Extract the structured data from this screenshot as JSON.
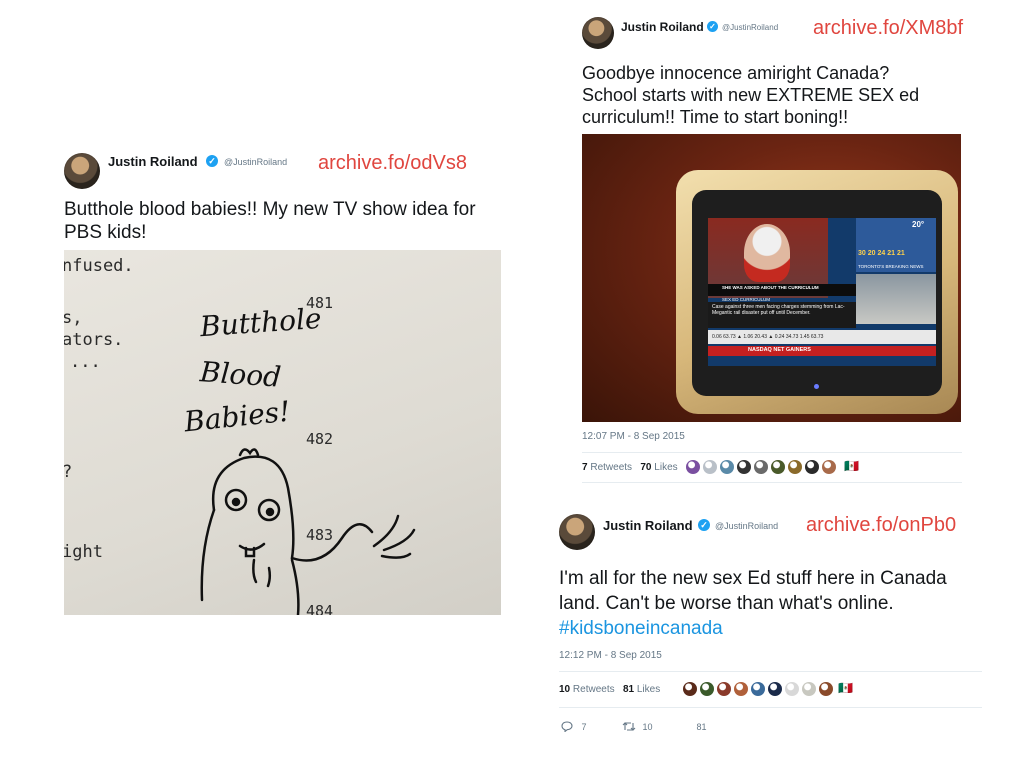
{
  "tweets": {
    "left": {
      "author": "Justin Roiland",
      "handle": "@JustinRoiland",
      "archive": "archive.fo/odVs8",
      "text": "Butthole blood babies!! My new TV show idea for PBS kids!",
      "photo": {
        "typed_text": [
          "nfused.",
          "s,",
          "ators.",
          "...",
          "?",
          "ight"
        ],
        "line_numbers": [
          "481",
          "482",
          "483",
          "484"
        ],
        "handwritten": [
          "Butthole",
          "Blood",
          "Babies!"
        ]
      }
    },
    "top_right": {
      "author": "Justin Roiland",
      "handle": "@JustinRoiland",
      "archive": "archive.fo/XM8bf",
      "text": "Goodbye innocence amiright Canada? School starts with new EXTREME SEX ed curriculum!! Time to start boning!!",
      "timestamp": "12:07 PM - 8 Sep 2015",
      "retweets": "7",
      "retweets_label": "Retweets",
      "likes": "70",
      "likes_label": "Likes",
      "liker_colors": [
        "#7a4fa0",
        "#b9c0c8",
        "#5a8aa8",
        "#333333",
        "#6a6a6a",
        "#4a5a2a",
        "#8a6a2a",
        "#2a2a2a",
        "#a86a4a"
      ],
      "flag_emoji": "🇲🇽"
    },
    "bottom_right": {
      "author": "Justin Roiland",
      "handle": "@JustinRoiland",
      "archive": "archive.fo/onPb0",
      "text_main": "I'm all for the new sex Ed stuff here in Canada land. Can't be worse than what's online.",
      "hashtag": "#kidsboneincanada",
      "timestamp": "12:12 PM - 8 Sep 2015",
      "retweets": "10",
      "retweets_label": "Retweets",
      "likes": "81",
      "likes_label": "Likes",
      "liker_colors": [
        "#5a2a1a",
        "#3a5a2a",
        "#8a3a2a",
        "#b0603a",
        "#3a6a9a",
        "#1a2a4a",
        "#d8d8d8",
        "#c8c8c0",
        "#8a4a2a"
      ],
      "flag_emoji": "🇲🇽",
      "reply_count": "7",
      "retweet_count": "10",
      "like_count": "81"
    }
  },
  "tv_screen": {
    "caption_1": "SHE WAS ASKED ABOUT THE CURRICULUM",
    "caption_2": "SEX ED CURRICULUM",
    "headline": "Case against three men facing charges stemming from Lac-Megantic rail disaster put off until December.",
    "ticker": "NASDAQ NET GAINERS",
    "weather_temps": [
      "30",
      "20",
      "24",
      "21",
      "21"
    ],
    "weather_temp": "20°",
    "news_label": "TORONTO'S BREAKING NEWS",
    "ticker_values": "0.06  63.73 ▲ 1.06  20.43 ▲ 0.24  34.73  1.45  63.73"
  },
  "colors": {
    "archive_red": "#e0463f",
    "verified_blue": "#1da1f2",
    "hashtag_blue": "#1b95e0"
  }
}
